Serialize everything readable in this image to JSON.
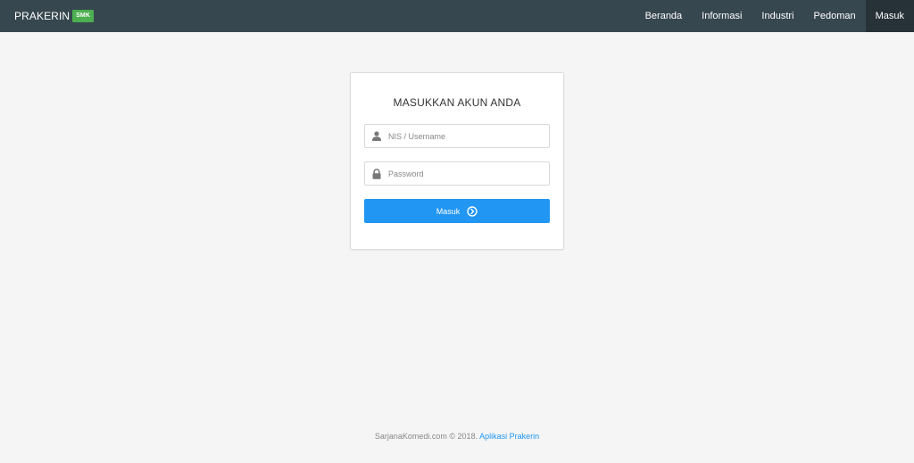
{
  "navbar": {
    "brand": "PRAKERIN",
    "badge": "SMK",
    "items": [
      {
        "label": "Beranda",
        "active": false
      },
      {
        "label": "Informasi",
        "active": false
      },
      {
        "label": "Industri",
        "active": false
      },
      {
        "label": "Pedoman",
        "active": false
      },
      {
        "label": "Masuk",
        "active": true
      }
    ]
  },
  "login": {
    "title": "MASUKKAN AKUN ANDA",
    "username_placeholder": "NIS / Username",
    "username_value": "",
    "password_placeholder": "Password",
    "password_value": "",
    "submit_label": "Masuk"
  },
  "footer": {
    "text": "SarjanaKomedi.com © 2018.",
    "link": "Aplikasi Prakerin"
  },
  "colors": {
    "navbar": "#37474f",
    "nav_active": "#263238",
    "badge": "#4caf50",
    "primary": "#2196f3"
  },
  "icons": {
    "username": "user-icon",
    "password": "lock-icon",
    "submit": "arrow-circle-right-icon"
  }
}
